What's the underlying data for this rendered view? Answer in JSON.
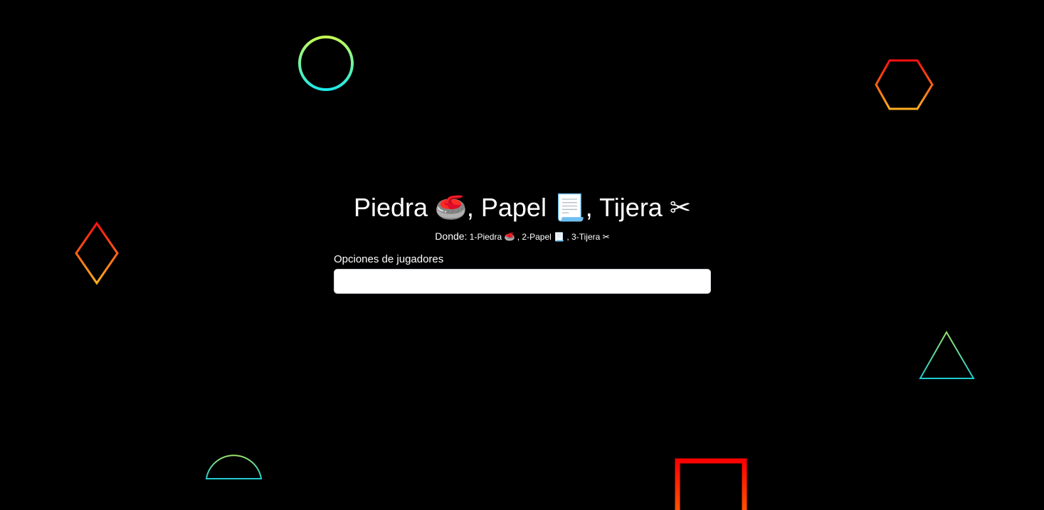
{
  "header": {
    "title_parts": [
      "Piedra ",
      "🥌",
      ", Papel ",
      "📃",
      ", Tijera ",
      "✂"
    ],
    "subtitle_lead": "Donde:",
    "subtitle_options": " 1-Piedra 🥌 , 2-Papel 📃 , 3-Tijera ✂"
  },
  "form": {
    "label": "Opciones de jugadores",
    "value": "",
    "placeholder": ""
  },
  "decorations": {
    "circle": {
      "colors": [
        "#c6ff55",
        "#1de9e9"
      ]
    },
    "hexagon": {
      "colors": [
        "#ff1010",
        "#ffb020"
      ]
    },
    "diamond": {
      "colors": [
        "#ff1010",
        "#ffb020"
      ]
    },
    "triangle": {
      "colors": [
        "#9be36b",
        "#1ecbd0"
      ]
    },
    "semicircle": {
      "colors": [
        "#9be36b",
        "#1ecbd0"
      ]
    },
    "square": {
      "colors": [
        "#ff0000",
        "#ff6a00"
      ]
    }
  }
}
